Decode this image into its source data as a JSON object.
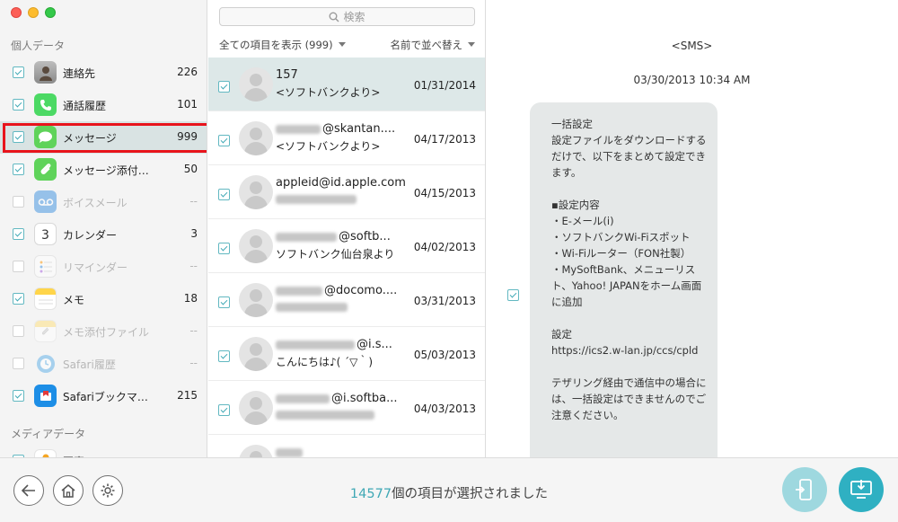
{
  "sidebar": {
    "personal_title": "個人データ",
    "media_title": "メディアデータ",
    "items": [
      {
        "label": "連絡先",
        "count": "226",
        "icon": "contacts-icon",
        "checked": true,
        "enabled": true
      },
      {
        "label": "通話履歴",
        "count": "101",
        "icon": "phone-icon",
        "checked": true,
        "enabled": true
      },
      {
        "label": "メッセージ",
        "count": "999",
        "icon": "messages-icon",
        "checked": true,
        "enabled": true,
        "selected": true
      },
      {
        "label": "メッセージ添付…",
        "count": "50",
        "icon": "message-attachment-icon",
        "checked": true,
        "enabled": true
      },
      {
        "label": "ボイスメール",
        "count": "--",
        "icon": "voicemail-icon",
        "checked": false,
        "enabled": false
      },
      {
        "label": "カレンダー",
        "count": "3",
        "icon": "calendar-icon",
        "checked": true,
        "enabled": true,
        "calendar_day": "3"
      },
      {
        "label": "リマインダー",
        "count": "--",
        "icon": "reminders-icon",
        "checked": false,
        "enabled": false
      },
      {
        "label": "メモ",
        "count": "18",
        "icon": "notes-icon",
        "checked": true,
        "enabled": true
      },
      {
        "label": "メモ添付ファイル",
        "count": "--",
        "icon": "notes-attachment-icon",
        "checked": false,
        "enabled": false
      },
      {
        "label": "Safari履歴",
        "count": "--",
        "icon": "safari-history-icon",
        "checked": false,
        "enabled": false
      },
      {
        "label": "Safariブックマ…",
        "count": "215",
        "icon": "safari-bookmarks-icon",
        "checked": true,
        "enabled": true
      }
    ],
    "media_items": [
      {
        "label": "写真",
        "icon": "photos-icon"
      }
    ]
  },
  "list": {
    "search_placeholder": "検索",
    "filter_label": "全ての項目を表示 (999)",
    "sort_label": "名前で並べ替え",
    "messages": [
      {
        "line1": "157",
        "line2": "<ソフトバンクより>",
        "date": "01/31/2014",
        "selected": true
      },
      {
        "line1": "@skantan....",
        "line2": "<ソフトバンクより>",
        "date": "04/17/2013"
      },
      {
        "line1": "appleid@id.apple.com",
        "line2": "",
        "date": "04/15/2013"
      },
      {
        "line1": "@softb...",
        "line2": "ソフトバンク仙台泉より",
        "date": "04/02/2013"
      },
      {
        "line1": "@docomo....",
        "line2": "",
        "date": "03/31/2013"
      },
      {
        "line1": "@i.s...",
        "line2": "こんにちは♪( ´▽｀)",
        "date": "05/03/2013"
      },
      {
        "line1": "@i.softba...",
        "line2": "",
        "date": "04/03/2013"
      },
      {
        "line1": "",
        "line2": "",
        "date": ""
      }
    ]
  },
  "detail": {
    "sms_label": "<SMS>",
    "timestamp": "03/30/2013 10:34 AM",
    "message_body": "一括設定\n設定ファイルをダウンロードするだけで、以下をまとめて設定できます。\n\n▪設定内容\n・E-メール(i)\n・ソフトバンクWi-Fiスポット\n・Wi-Fiルーター（FON社製）\n・MySoftBank、メニューリスト、Yahoo! JAPANをホーム画面に追加\n\n設定\nhttps://ics2.w-lan.jp/ccs/cpld\n\nテザリング経由で通信中の場合には、一括設定はできませんのでご注意ください。"
  },
  "footer": {
    "selected_count": "14577",
    "selected_text": "個の項目が選択されました"
  },
  "colors": {
    "accent": "#3fa8b5",
    "highlight": "#e8141c",
    "selected_row": "#dde8e8"
  }
}
